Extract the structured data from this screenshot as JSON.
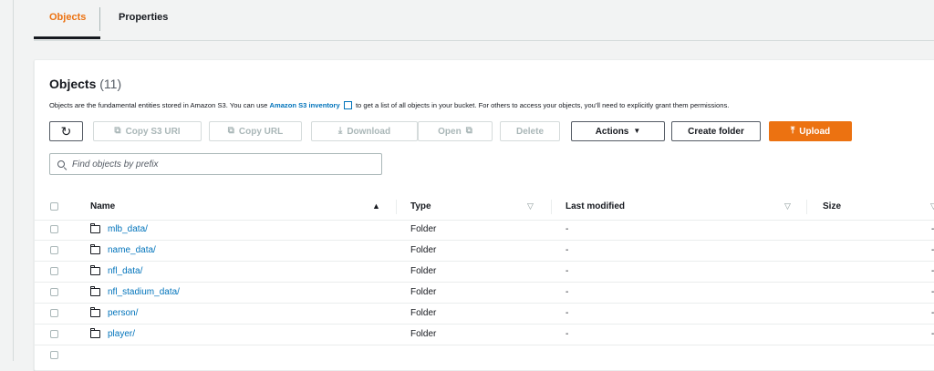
{
  "tabs": [
    {
      "label": "Objects",
      "active": true
    },
    {
      "label": "Properties",
      "active": false
    }
  ],
  "panel": {
    "title": "Objects",
    "count": "(11)",
    "description_prefix": "Objects are the fundamental entities stored in Amazon S3. You can use ",
    "description_link": "Amazon S3 inventory",
    "description_suffix": " to get a list of all objects in your bucket. For others to access your objects, you’ll need to explicitly grant them permissions."
  },
  "toolbar": {
    "refresh_icon": "refresh-icon",
    "copy_s3_uri": "Copy S3 URI",
    "copy_url": "Copy URL",
    "download": "Download",
    "open": "Open",
    "delete": "Delete",
    "actions": "Actions",
    "create_folder": "Create folder",
    "upload": "Upload"
  },
  "search": {
    "placeholder": "Find objects by prefix",
    "value": ""
  },
  "table": {
    "columns": {
      "name": "Name",
      "type": "Type",
      "last_modified": "Last modified",
      "size": "Size"
    },
    "rows": [
      {
        "name": "mlb_data/",
        "type": "Folder",
        "last_modified": "-",
        "size": "-"
      },
      {
        "name": "name_data/",
        "type": "Folder",
        "last_modified": "-",
        "size": "-"
      },
      {
        "name": "nfl_data/",
        "type": "Folder",
        "last_modified": "-",
        "size": "-"
      },
      {
        "name": "nfl_stadium_data/",
        "type": "Folder",
        "last_modified": "-",
        "size": "-"
      },
      {
        "name": "person/",
        "type": "Folder",
        "last_modified": "-",
        "size": "-"
      },
      {
        "name": "player/",
        "type": "Folder",
        "last_modified": "-",
        "size": "-"
      }
    ]
  },
  "colors": {
    "accent": "#ec7211",
    "link": "#0073bb"
  }
}
